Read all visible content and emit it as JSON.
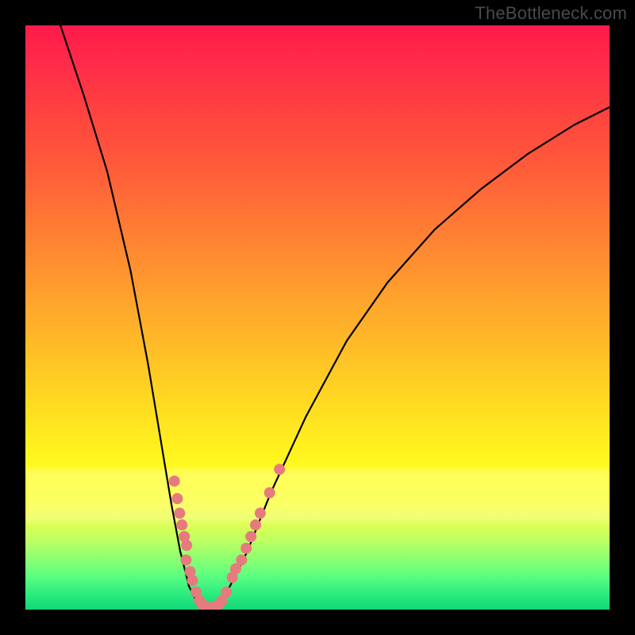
{
  "watermark": "TheBottleneck.com",
  "chart_data": {
    "type": "line",
    "title": "",
    "xlabel": "",
    "ylabel": "",
    "xlim": [
      0,
      100
    ],
    "ylim": [
      0,
      100
    ],
    "series": [
      {
        "name": "bottleneck-curve",
        "x": [
          6,
          10,
          14,
          18,
          21,
          23,
          25,
          26.5,
          28,
          29.5,
          31,
          33,
          35,
          38,
          42,
          48,
          55,
          62,
          70,
          78,
          86,
          94,
          100
        ],
        "y": [
          100,
          88,
          75,
          58,
          42,
          30,
          18,
          10,
          4,
          1,
          0,
          1,
          4,
          10,
          20,
          33,
          46,
          56,
          65,
          72,
          78,
          83,
          86
        ]
      }
    ],
    "markers": {
      "name": "data-points",
      "color": "#e77a7e",
      "points": [
        {
          "x": 25.5,
          "y": 22
        },
        {
          "x": 26.0,
          "y": 19
        },
        {
          "x": 26.4,
          "y": 16.5
        },
        {
          "x": 26.8,
          "y": 14.5
        },
        {
          "x": 27.2,
          "y": 12.5
        },
        {
          "x": 27.6,
          "y": 11
        },
        {
          "x": 27.5,
          "y": 8.5
        },
        {
          "x": 28.2,
          "y": 6.5
        },
        {
          "x": 28.6,
          "y": 5
        },
        {
          "x": 29.2,
          "y": 3
        },
        {
          "x": 29.8,
          "y": 1.5
        },
        {
          "x": 30.3,
          "y": 0.8
        },
        {
          "x": 30.9,
          "y": 0.4
        },
        {
          "x": 31.6,
          "y": 0.3
        },
        {
          "x": 32.3,
          "y": 0.4
        },
        {
          "x": 33.0,
          "y": 0.8
        },
        {
          "x": 33.6,
          "y": 1.5
        },
        {
          "x": 34.4,
          "y": 3
        },
        {
          "x": 35.4,
          "y": 5.5
        },
        {
          "x": 36.0,
          "y": 7
        },
        {
          "x": 37.0,
          "y": 8.5
        },
        {
          "x": 37.8,
          "y": 10.5
        },
        {
          "x": 38.6,
          "y": 12.5
        },
        {
          "x": 39.4,
          "y": 14.5
        },
        {
          "x": 40.2,
          "y": 16.5
        },
        {
          "x": 41.8,
          "y": 20
        },
        {
          "x": 43.5,
          "y": 24
        }
      ]
    },
    "background": {
      "type": "vertical-gradient",
      "stops": [
        {
          "pos": 0.0,
          "color": "#ff1a4a"
        },
        {
          "pos": 0.5,
          "color": "#ffc024"
        },
        {
          "pos": 0.78,
          "color": "#ffff20"
        },
        {
          "pos": 1.0,
          "color": "#18d878"
        }
      ]
    }
  }
}
